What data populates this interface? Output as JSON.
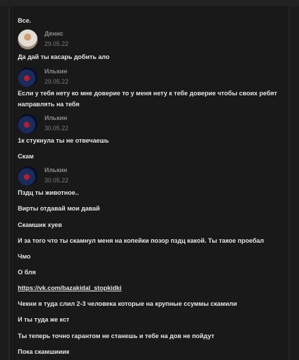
{
  "messages_before": [
    {
      "text": "Все."
    }
  ],
  "groups": [
    {
      "author": "Денис",
      "date": "29.05.22",
      "messages": [
        "Да дай ты касарь добить ало"
      ]
    },
    {
      "author": "Илькин",
      "date": "29.05.22",
      "messages": [
        "Если у тебя нету ко мне доверие то у меня нету к тебе доверие чтобы своих ребят направлять на тебя"
      ]
    },
    {
      "author": "Илькин",
      "date": "30.05.22",
      "messages": [
        "1к стукнула ты не отвечаешь",
        "Скам"
      ]
    },
    {
      "author": "Илькин",
      "date": "30.05.22",
      "messages": [
        "Пздц ты животное..",
        "Вирты отдавай мои давай",
        "Скамшик хуев",
        "И за того что ты скамнул меня на копейки позор пздц какой. Ты такое проебал",
        "Чмо",
        "О бля",
        "https://vk.com/bazakidal_stopkidki",
        "Чекни я туда слил 2-3 человека которые на крупные ссуммы скамили",
        "И ты туда же кст",
        "Ты теперь точно гарантом не станешь и тебе на дов не пойдут",
        "Пока скамшииик"
      ]
    }
  ]
}
